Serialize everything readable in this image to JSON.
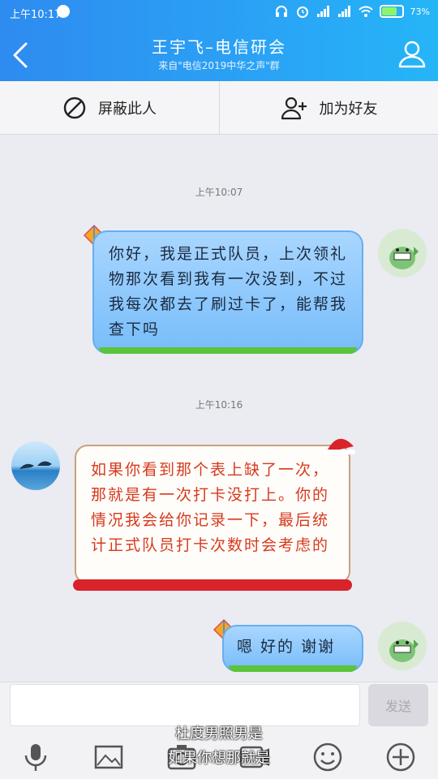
{
  "status_bar": {
    "time": "上午10:17",
    "battery_percent": "73%",
    "battery_level": 0.73
  },
  "header": {
    "title": "王宇飞–电信研会",
    "subtitle": "来自\"电信2019中华之声\"群"
  },
  "actions": {
    "block": "屏蔽此人",
    "add_friend": "加为好友"
  },
  "messages": [
    {
      "type": "timestamp",
      "text": "上午10:07"
    },
    {
      "type": "sent",
      "text": "你好，我是正式队员，上次领礼物那次看到我有一次没到，不过我每次都去了刷过卡了，能帮我查下吗"
    },
    {
      "type": "timestamp",
      "text": "上午10:16"
    },
    {
      "type": "received",
      "text": "如果你看到那个表上缺了一次，那就是有一次打卡没打上。你的情况我会给你记录一下，最后统计正式队员打卡次数时会考虑的"
    },
    {
      "type": "sent",
      "text": "嗯 好的 谢谢"
    }
  ],
  "input": {
    "send_label": "发送"
  },
  "watermark": {
    "line1": "杜度男照男是",
    "line2": "如果你想那就是"
  },
  "colors": {
    "header_start": "#2e8bf0",
    "header_end": "#25b5f7",
    "sent_bubble": "#78bdfa",
    "received_text": "#d6391e"
  }
}
